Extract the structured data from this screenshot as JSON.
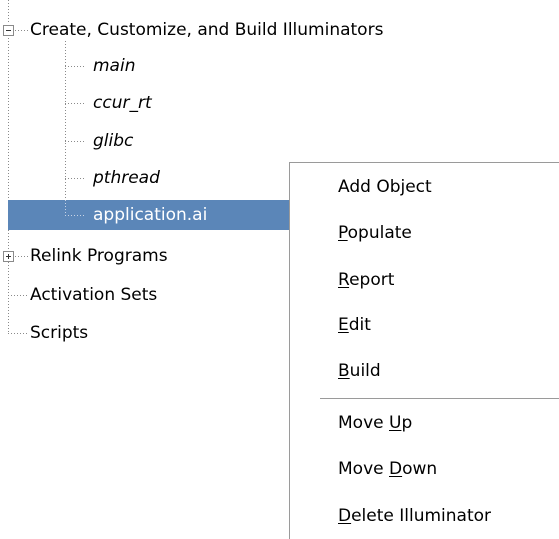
{
  "tree": {
    "root_label": "Create, Customize, and Build Illuminators",
    "children": [
      {
        "label": "main"
      },
      {
        "label": "ccur_rt"
      },
      {
        "label": "glibc"
      },
      {
        "label": "pthread"
      },
      {
        "label": "application.ai"
      }
    ],
    "siblings": [
      {
        "label": "Relink Programs"
      },
      {
        "label": "Activation Sets"
      },
      {
        "label": "Scripts"
      }
    ]
  },
  "context_menu": {
    "items": [
      {
        "pre": "Add Object",
        "mn": "",
        "post": ""
      },
      {
        "pre": "",
        "mn": "P",
        "post": "opulate"
      },
      {
        "pre": "",
        "mn": "R",
        "post": "eport"
      },
      {
        "pre": "",
        "mn": "E",
        "post": "dit"
      },
      {
        "pre": "",
        "mn": "B",
        "post": "uild"
      },
      {
        "pre": "Move ",
        "mn": "U",
        "post": "p"
      },
      {
        "pre": "Move ",
        "mn": "D",
        "post": "own"
      },
      {
        "pre": "",
        "mn": "D",
        "post": "elete Illuminator"
      }
    ]
  },
  "colors": {
    "selection": "#5b86b8",
    "tree_line": "#8a8a8a",
    "menu_border": "#9a9a9a"
  }
}
